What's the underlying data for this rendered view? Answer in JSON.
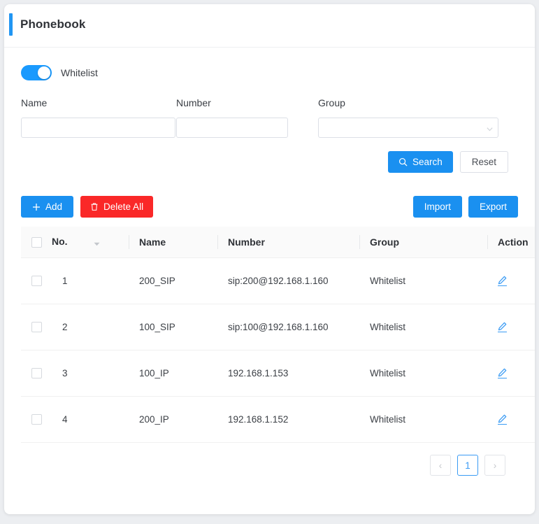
{
  "header": {
    "title": "Phonebook",
    "accent_color": "#2196f3"
  },
  "toggle": {
    "label": "Whitelist",
    "state": "on"
  },
  "search_form": {
    "fields": [
      {
        "label": "Name",
        "value": "",
        "placeholder": "",
        "type": "text"
      },
      {
        "label": "Number",
        "value": "",
        "placeholder": "",
        "type": "text"
      },
      {
        "label": "Group",
        "value": "",
        "placeholder": "",
        "type": "select"
      }
    ],
    "search_label": "Search",
    "reset_label": "Reset"
  },
  "toolbar": {
    "add_label": "Add",
    "delete_all_label": "Delete All",
    "import_label": "Import",
    "export_label": "Export",
    "add_color": "#1a90f0",
    "delete_color": "#fa2828"
  },
  "table": {
    "columns": [
      "No.",
      "Name",
      "Number",
      "Group",
      "Action"
    ],
    "rows": [
      {
        "no": "1",
        "name": "200_SIP",
        "number": "sip:200@192.168.1.160",
        "group": "Whitelist"
      },
      {
        "no": "2",
        "name": "100_SIP",
        "number": "sip:100@192.168.1.160",
        "group": "Whitelist"
      },
      {
        "no": "3",
        "name": "100_IP",
        "number": "192.168.1.153",
        "group": "Whitelist"
      },
      {
        "no": "4",
        "name": "200_IP",
        "number": "192.168.1.152",
        "group": "Whitelist"
      }
    ]
  },
  "pagination": {
    "prev": "‹",
    "next": "›",
    "current_page": "1"
  }
}
